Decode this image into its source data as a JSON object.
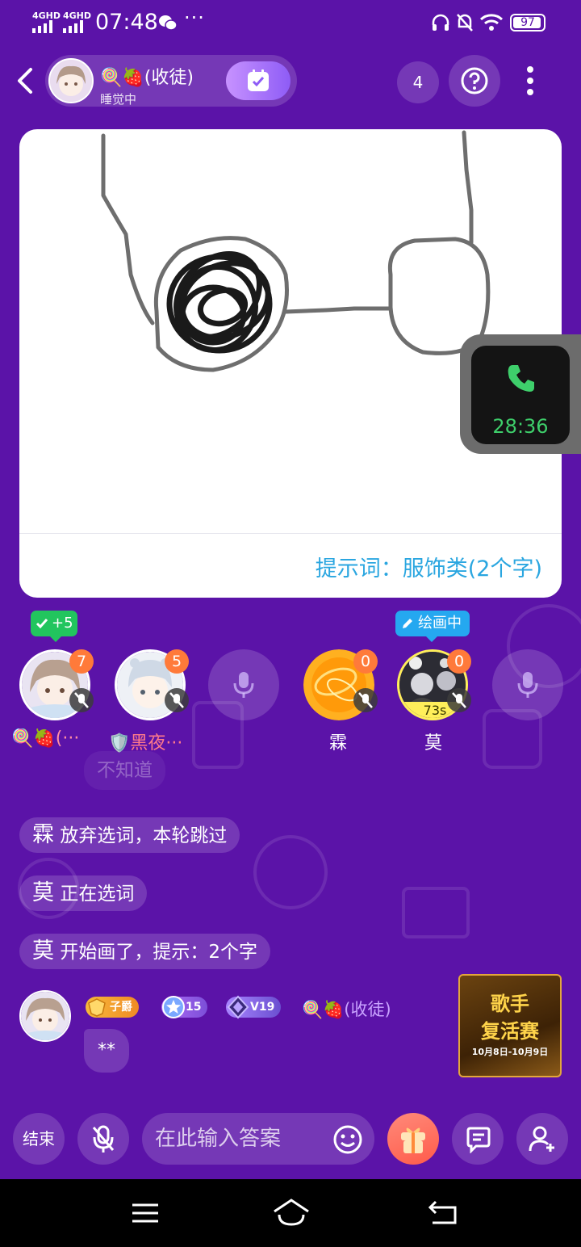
{
  "status_bar": {
    "network_1": "4GHD",
    "network_2": "4GHD",
    "time": "07:48",
    "more": "···",
    "battery": "97"
  },
  "header": {
    "room_name": "🍭🍓(收徒)",
    "room_status": "睡觉中",
    "online_count": "4"
  },
  "canvas": {
    "hint": "提示词：服饰类(2个字)"
  },
  "call_widget": {
    "duration": "28:36"
  },
  "badges": {
    "plus": "+5",
    "drawing": "绘画中"
  },
  "seats": [
    {
      "name": "🍭🍓(···",
      "score": "7"
    },
    {
      "name": "🛡️黑夜···",
      "score": "5"
    },
    {
      "name": "",
      "score": ""
    },
    {
      "name": "霖",
      "score": "0"
    },
    {
      "name": "莫",
      "score": "0",
      "timer": "73s"
    },
    {
      "name": "",
      "score": ""
    }
  ],
  "chat": {
    "faded_message": "不知道",
    "messages": [
      {
        "who": "霖",
        "text": "放弃选词，本轮跳过"
      },
      {
        "who": "莫",
        "text": "正在选词"
      },
      {
        "who": "莫",
        "text": "开始画了，提示：2个字"
      }
    ],
    "user_message": {
      "title_badge": "子爵",
      "level_badge": "15",
      "vip_badge": "V19",
      "name": "🍭🍓(收徒)",
      "text": "**"
    }
  },
  "event_banner": {
    "line1": "歌手",
    "line2": "复活赛",
    "dates": "10月8日-10月9日"
  },
  "bottom_bar": {
    "end_label": "结束",
    "input_placeholder": "在此输入答案"
  },
  "colors": {
    "background": "#5b13a8",
    "hint": "#2aa6e0",
    "call_time": "#3ecf6b",
    "score_badge": "#ff7a3a"
  }
}
